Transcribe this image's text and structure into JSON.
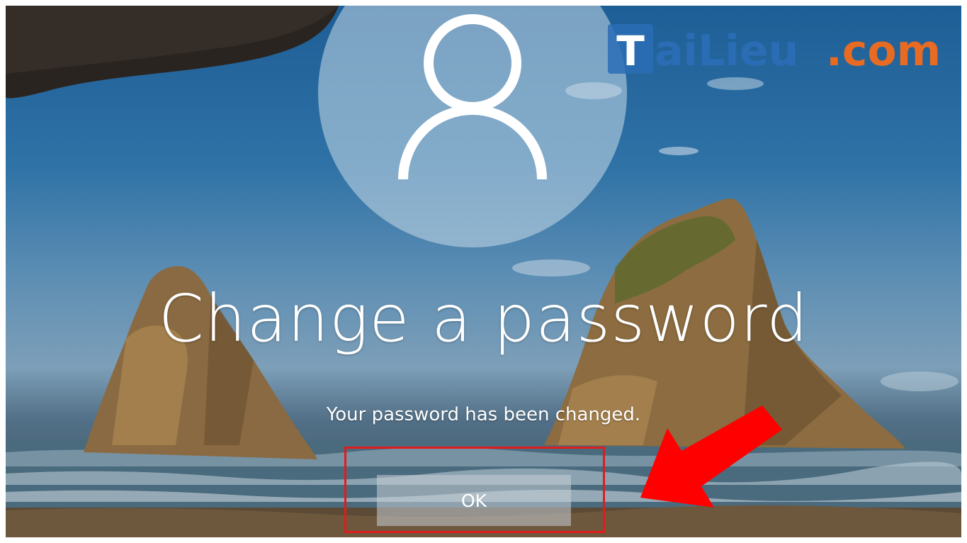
{
  "dialog": {
    "title": "Change a password",
    "message": "Your password has been changed.",
    "ok_label": "OK"
  },
  "annotation": {
    "highlight_color": "#e01d1d",
    "arrow_color": "#ff0000"
  },
  "watermark": {
    "text": "TaiLieu.com",
    "colors": {
      "Tai": "#2a6db5",
      "Lieu": "#2a6db5",
      "com": "#e76b22"
    }
  },
  "icons": {
    "avatar": "user-icon"
  }
}
